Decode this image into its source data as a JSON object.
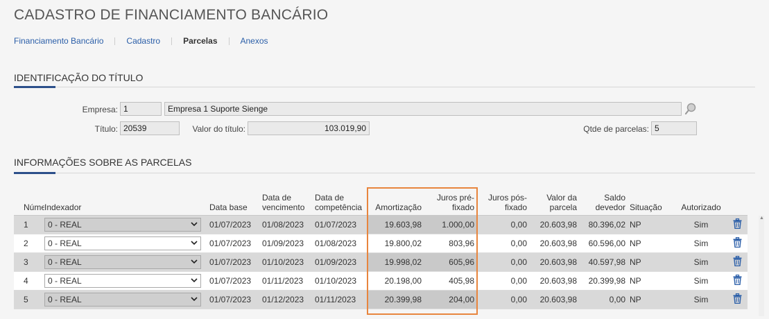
{
  "page": {
    "title": "CADASTRO DE FINANCIAMENTO BANCÁRIO"
  },
  "nav": {
    "tabs": [
      {
        "label": "Financiamento Bancário",
        "active": false
      },
      {
        "label": "Cadastro",
        "active": false
      },
      {
        "label": "Parcelas",
        "active": true
      },
      {
        "label": "Anexos",
        "active": false
      }
    ]
  },
  "identificacao": {
    "title": "IDENTIFICAÇÃO DO TÍTULO",
    "empresa_label": "Empresa:",
    "empresa_code": "1",
    "empresa_name": "Empresa 1 Suporte Sienge",
    "titulo_label": "Título:",
    "titulo_value": "20539",
    "valor_label": "Valor do título:",
    "valor_value": "103.019,90",
    "qtde_label": "Qtde de parcelas:",
    "qtde_value": "5"
  },
  "parcelas": {
    "title": "INFORMAÇÕES SOBRE AS PARCELAS",
    "headers": {
      "numero": "Número",
      "indexador": "Indexador",
      "data_base": "Data base",
      "data_venc_1": "Data de",
      "data_venc_2": "vencimento",
      "data_comp_1": "Data de",
      "data_comp_2": "competência",
      "amortizacao": "Amortização",
      "juros_pre_1": "Juros pré-",
      "juros_pre_2": "fixado",
      "juros_pos_1": "Juros pós-",
      "juros_pos_2": "fixado",
      "valor_parcela_1": "Valor da",
      "valor_parcela_2": "parcela",
      "saldo_1": "Saldo",
      "saldo_2": "devedor",
      "situacao": "Situação",
      "autorizado": "Autorizado"
    },
    "rows": [
      {
        "numero": "1",
        "indexador": "0 - REAL",
        "data_base": "01/07/2023",
        "vencimento": "01/08/2023",
        "competencia": "01/07/2023",
        "amortizacao": "19.603,98",
        "juros_pre": "1.000,00",
        "juros_pos": "0,00",
        "valor_parcela": "20.603,98",
        "saldo": "80.396,02",
        "situacao": "NP",
        "autorizado": "Sim"
      },
      {
        "numero": "2",
        "indexador": "0 - REAL",
        "data_base": "01/07/2023",
        "vencimento": "01/09/2023",
        "competencia": "01/08/2023",
        "amortizacao": "19.800,02",
        "juros_pre": "803,96",
        "juros_pos": "0,00",
        "valor_parcela": "20.603,98",
        "saldo": "60.596,00",
        "situacao": "NP",
        "autorizado": "Sim"
      },
      {
        "numero": "3",
        "indexador": "0 - REAL",
        "data_base": "01/07/2023",
        "vencimento": "01/10/2023",
        "competencia": "01/09/2023",
        "amortizacao": "19.998,02",
        "juros_pre": "605,96",
        "juros_pos": "0,00",
        "valor_parcela": "20.603,98",
        "saldo": "40.597,98",
        "situacao": "NP",
        "autorizado": "Sim"
      },
      {
        "numero": "4",
        "indexador": "0 - REAL",
        "data_base": "01/07/2023",
        "vencimento": "01/11/2023",
        "competencia": "01/10/2023",
        "amortizacao": "20.198,00",
        "juros_pre": "405,98",
        "juros_pos": "0,00",
        "valor_parcela": "20.603,98",
        "saldo": "20.399,98",
        "situacao": "NP",
        "autorizado": "Sim"
      },
      {
        "numero": "5",
        "indexador": "0 - REAL",
        "data_base": "01/07/2023",
        "vencimento": "01/12/2023",
        "competencia": "01/11/2023",
        "amortizacao": "20.399,98",
        "juros_pre": "204,00",
        "juros_pos": "0,00",
        "valor_parcela": "20.603,98",
        "saldo": "0,00",
        "situacao": "NP",
        "autorizado": "Sim"
      }
    ]
  },
  "colors": {
    "accent": "#2c4f8a",
    "link": "#2a5ea8",
    "highlight": "#e8853d",
    "trash": "#2a5ea8"
  },
  "icons": {
    "search": "search-icon",
    "delete": "trash-icon",
    "dropdown": "chevron-down-icon"
  }
}
